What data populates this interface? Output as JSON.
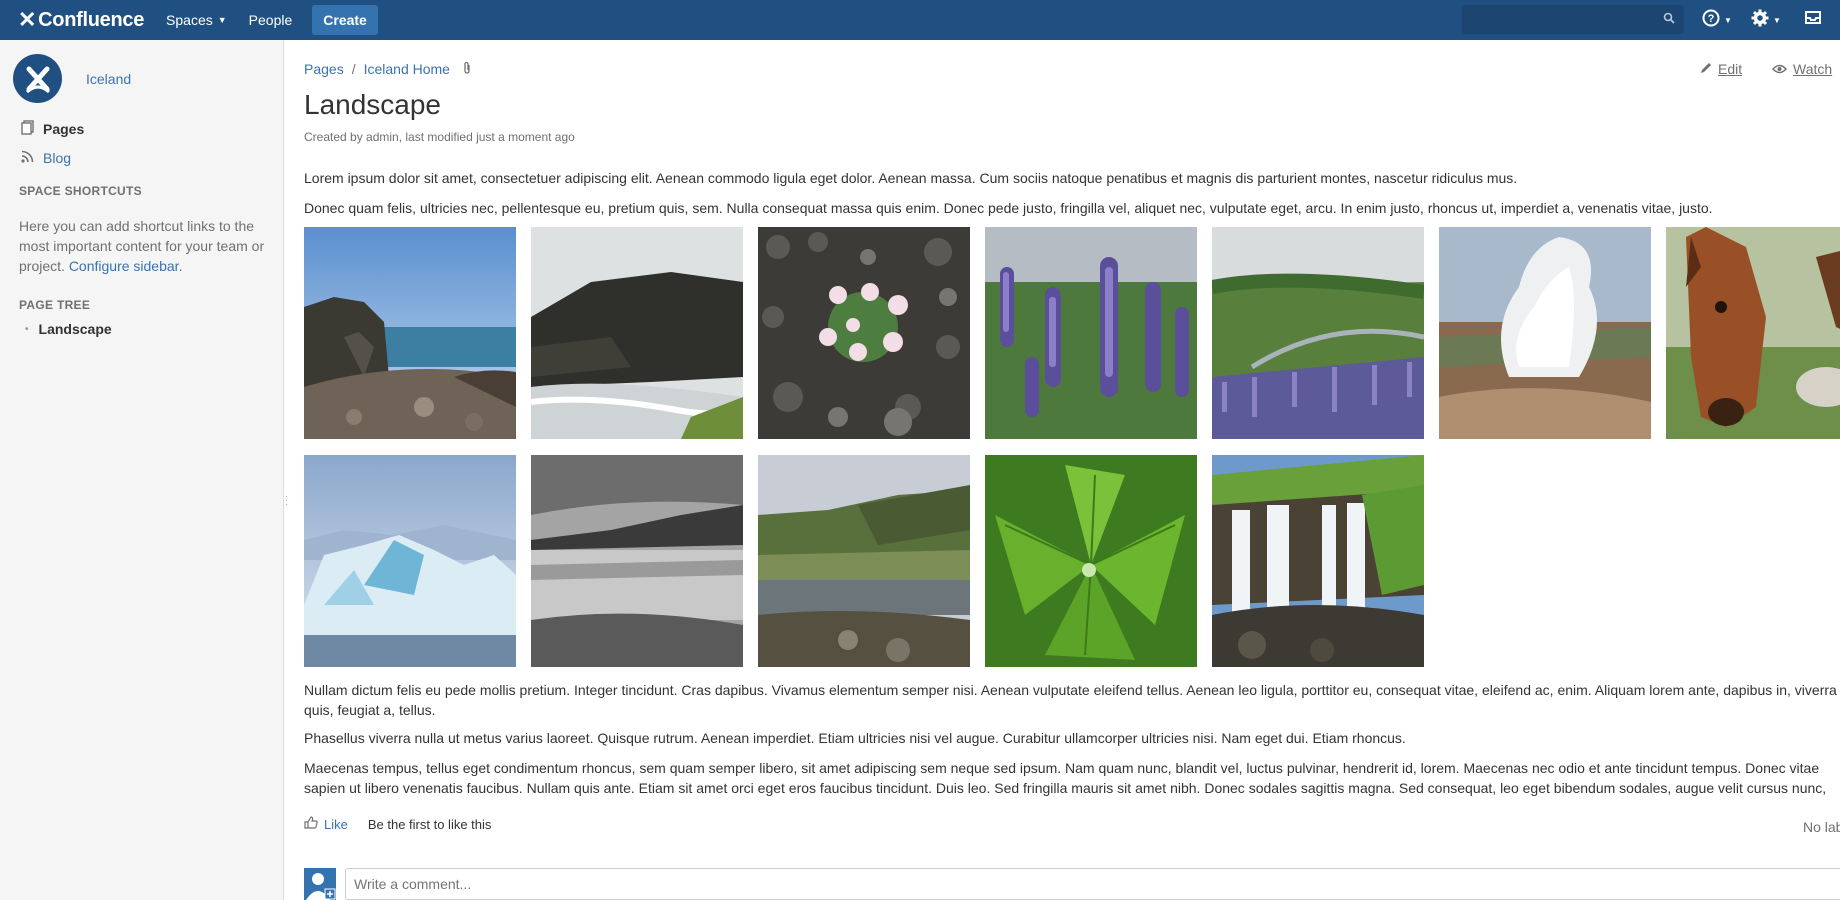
{
  "topnav": {
    "logo_text": "Confluence",
    "spaces_label": "Spaces",
    "people_label": "People",
    "create_label": "Create",
    "search_placeholder": ""
  },
  "sidebar": {
    "space_name": "Iceland",
    "pages_label": "Pages",
    "blog_label": "Blog",
    "shortcuts_heading": "SPACE SHORTCUTS",
    "shortcuts_text": "Here you can add shortcut links to the most important content for your team or project.",
    "configure_link": "Configure sidebar",
    "tree_heading": "PAGE TREE",
    "tree_items": [
      "Landscape"
    ]
  },
  "page": {
    "breadcrumb": [
      "Pages",
      "Iceland Home"
    ],
    "edit_label": "Edit",
    "watch_label": "Watch",
    "title": "Landscape",
    "byline": "Created by admin, last modified just a moment ago",
    "paragraphs_top": [
      "Lorem ipsum dolor sit amet, consectetuer adipiscing elit. Aenean commodo ligula eget dolor. Aenean massa. Cum sociis natoque penatibus et magnis dis parturient montes, nascetur ridiculus mus.",
      "Donec quam felis, ultricies nec, pellentesque eu, pretium quis, sem. Nulla consequat massa quis enim. Donec pede justo, fringilla vel, aliquet nec, vulputate eget, arcu. In enim justo, rhoncus ut, imperdiet a, venenatis vitae, justo."
    ],
    "paragraphs_bottom": [
      "Nullam dictum felis eu pede mollis pretium. Integer tincidunt. Cras dapibus. Vivamus elementum semper nisi. Aenean vulputate eleifend tellus. Aenean leo ligula, porttitor eu, consequat vitae, eleifend ac, enim. Aliquam lorem ante, dapibus in, viverra quis, feugiat a, tellus.",
      "Phasellus viverra nulla ut metus varius laoreet. Quisque rutrum. Aenean imperdiet. Etiam ultricies nisi vel augue. Curabitur ullamcorper ultricies nisi. Nam eget dui. Etiam rhoncus.",
      "Maecenas tempus, tellus eget condimentum rhoncus, sem quam semper libero, sit amet adipiscing sem neque sed ipsum. Nam quam nunc, blandit vel, luctus pulvinar, hendrerit id, lorem. Maecenas nec odio et ante tincidunt tempus. Donec vitae sapien ut libero venenatis faucibus. Nullam quis ante. Etiam sit amet orci eget eros faucibus tincidunt. Duis leo. Sed fringilla mauris sit amet nibh. Donec sodales sagittis magna. Sed consequat, leo eget bibendum sodales, augue velit cursus nunc,"
    ],
    "gallery": [
      "coastal-cliffs-photo",
      "misty-sea-cliff-photo",
      "pink-flowers-on-gravel-photo",
      "purple-lupines-photo",
      "lupine-valley-photo",
      "geothermal-steam-photo",
      "icelandic-horse-photo",
      "glacier-ice-photo",
      "black-white-lake-photo",
      "highland-pond-photo",
      "green-leaf-dewdrop-photo",
      "waterfall-photo"
    ],
    "like_label": "Like",
    "like_text": "Be the first to like this",
    "labels_text": "No labels",
    "comment_placeholder": "Write a comment..."
  },
  "colors": {
    "header_bg": "#205081",
    "link": "#3b73af",
    "create_button": "#3572b0"
  }
}
